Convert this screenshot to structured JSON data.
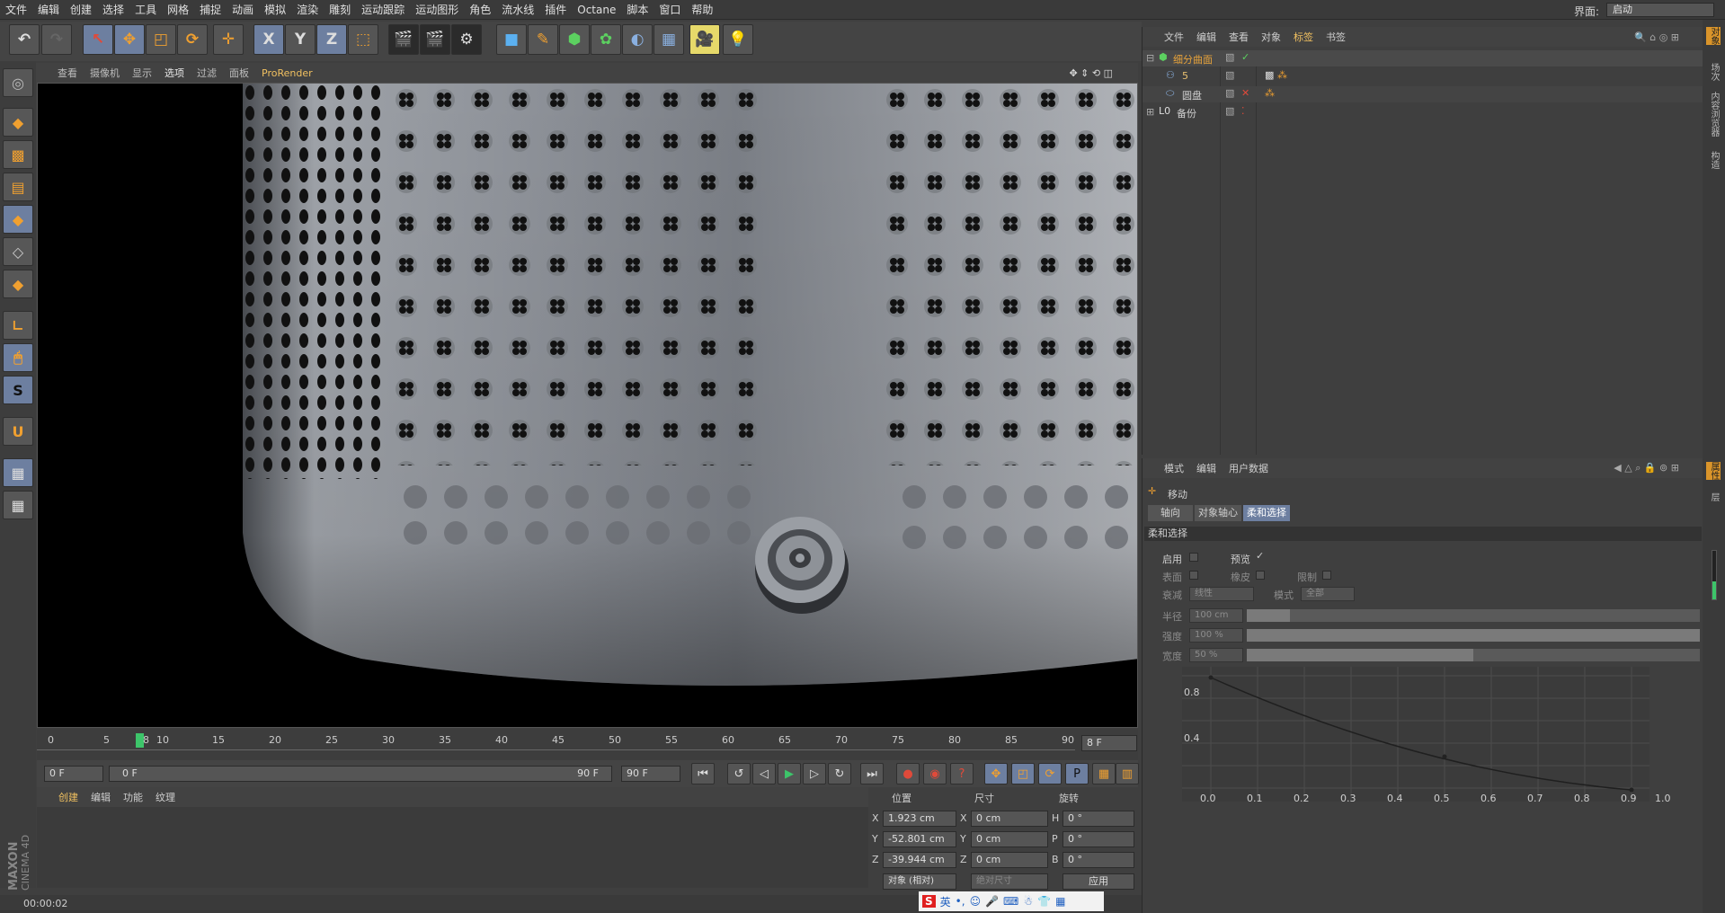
{
  "menubar": {
    "items": [
      "文件",
      "编辑",
      "创建",
      "选择",
      "工具",
      "网格",
      "捕捉",
      "动画",
      "模拟",
      "渲染",
      "雕刻",
      "运动跟踪",
      "运动图形",
      "角色",
      "流水线",
      "插件",
      "Octane",
      "脚本",
      "窗口",
      "帮助"
    ],
    "layout_label": "界面:",
    "layout_value": "启动"
  },
  "toolbar": {
    "axis_x": "X",
    "axis_y": "Y",
    "axis_z": "Z"
  },
  "viewport": {
    "menu": [
      "查看",
      "摄像机",
      "显示",
      "选项",
      "过滤",
      "面板"
    ],
    "prorender": "ProRender"
  },
  "timeline": {
    "ticks": [
      "0",
      "5",
      "8",
      "10",
      "15",
      "20",
      "25",
      "30",
      "35",
      "40",
      "45",
      "50",
      "55",
      "60",
      "65",
      "70",
      "75",
      "80",
      "85",
      "90"
    ],
    "current_frame": "8 F"
  },
  "transport": {
    "start": "0 F",
    "range_start": "0 F",
    "range_end": "90 F",
    "end": "90 F"
  },
  "material_manager": {
    "menu": [
      "创建",
      "编辑",
      "功能",
      "纹理"
    ]
  },
  "coords": {
    "headers": {
      "position": "位置",
      "size": "尺寸",
      "rotation": "旋转"
    },
    "rows": [
      {
        "axis": "X",
        "pos": "1.923 cm",
        "saxis": "X",
        "size": "0 cm",
        "raxis": "H",
        "rot": "0 °"
      },
      {
        "axis": "Y",
        "pos": "-52.801 cm",
        "saxis": "Y",
        "size": "0 cm",
        "raxis": "P",
        "rot": "0 °"
      },
      {
        "axis": "Z",
        "pos": "-39.944 cm",
        "saxis": "Z",
        "size": "0 cm",
        "raxis": "B",
        "rot": "0 °"
      }
    ],
    "mode": "对象 (相对)",
    "size_mode": "绝对尺寸",
    "apply": "应用"
  },
  "status": {
    "time": "00:00:02"
  },
  "brand": {
    "line1": "MAXON",
    "line2": "CINEMA 4D"
  },
  "object_manager": {
    "menu": [
      "文件",
      "编辑",
      "查看",
      "对象",
      "标签",
      "书签"
    ],
    "objects": [
      {
        "name": "细分曲面",
        "color": "#e8a33a"
      },
      {
        "name": "5",
        "color": "#e8c070"
      },
      {
        "name": "圆盘",
        "color": "#cfcfcf"
      },
      {
        "name": "备份",
        "color": "#cfcfcf"
      }
    ]
  },
  "attributes": {
    "menu": [
      "模式",
      "编辑",
      "用户数据"
    ],
    "tool": "移动",
    "tabs": [
      "轴向",
      "对象轴心",
      "柔和选择"
    ],
    "section": "柔和选择",
    "enable": "启用",
    "preview": "预览",
    "surface": "表面",
    "rubber": "橡皮",
    "limit": "限制",
    "falloff": "衰减",
    "falloff_val": "线性",
    "mode": "模式",
    "mode_val": "全部",
    "radius": "半径",
    "radius_val": "100 cm",
    "strength": "强度",
    "strength_val": "100 %",
    "width": "宽度",
    "width_val": "50 %",
    "graph_y": [
      "0.8",
      "0.4"
    ],
    "graph_x": [
      "0.0",
      "0.1",
      "0.2",
      "0.3",
      "0.4",
      "0.5",
      "0.6",
      "0.7",
      "0.8",
      "0.9",
      "1.0"
    ]
  },
  "side_tabs": [
    "对象",
    "场次",
    "内容浏览器",
    "构造"
  ],
  "side_tabs2": [
    "属性",
    "层"
  ],
  "taskbar": {
    "ime": "英"
  }
}
